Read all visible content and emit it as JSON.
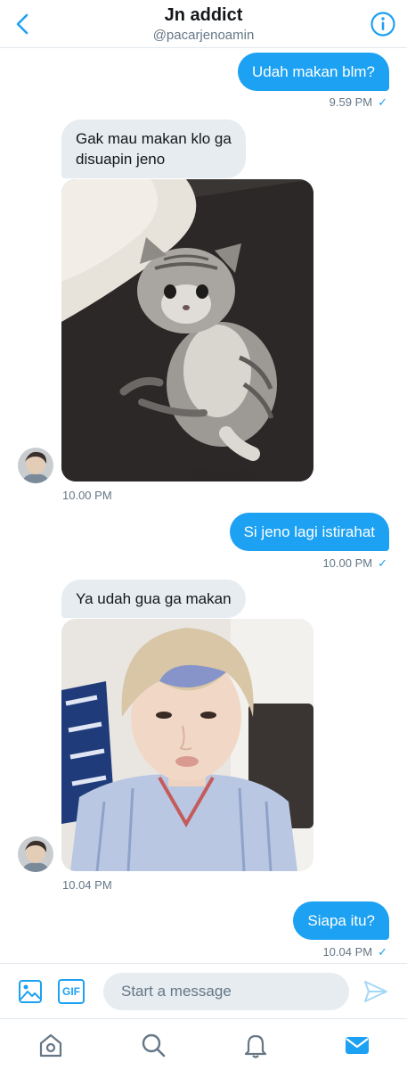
{
  "header": {
    "title": "Jn addict",
    "handle": "@pacarjenoamin",
    "back_icon": "chevron-left-icon",
    "info_icon": "info-circle-icon"
  },
  "messages": [
    {
      "direction": "outgoing",
      "text": "Udah makan blm?",
      "time": "9.59 PM",
      "read_mark": "✓"
    },
    {
      "direction": "incoming",
      "text": "Gak mau makan klo ga\ndisuapin jeno",
      "image": "kitten-photo",
      "time": "10.00 PM"
    },
    {
      "direction": "outgoing",
      "text": "Si jeno lagi istirahat",
      "time": "10.00 PM",
      "read_mark": "✓"
    },
    {
      "direction": "incoming",
      "text": "Ya udah gua ga makan",
      "image": "boy-portrait-photo",
      "time": "10.04 PM"
    },
    {
      "direction": "outgoing",
      "text": "Siapa itu?",
      "time": "10.04 PM",
      "read_mark": "✓"
    }
  ],
  "composer": {
    "placeholder": "Start a message",
    "gif_label": "GIF",
    "media_icon": "image-icon",
    "send_icon": "send-icon"
  },
  "tabbar": {
    "items": [
      "home-icon",
      "search-icon",
      "notifications-bell-icon",
      "messages-mail-icon"
    ],
    "active": "messages-mail-icon"
  },
  "colors": {
    "accent": "#1da1f2",
    "incoming_bubble": "#e6ecf0",
    "muted_text": "#657786",
    "divider": "#e1e8ed"
  }
}
